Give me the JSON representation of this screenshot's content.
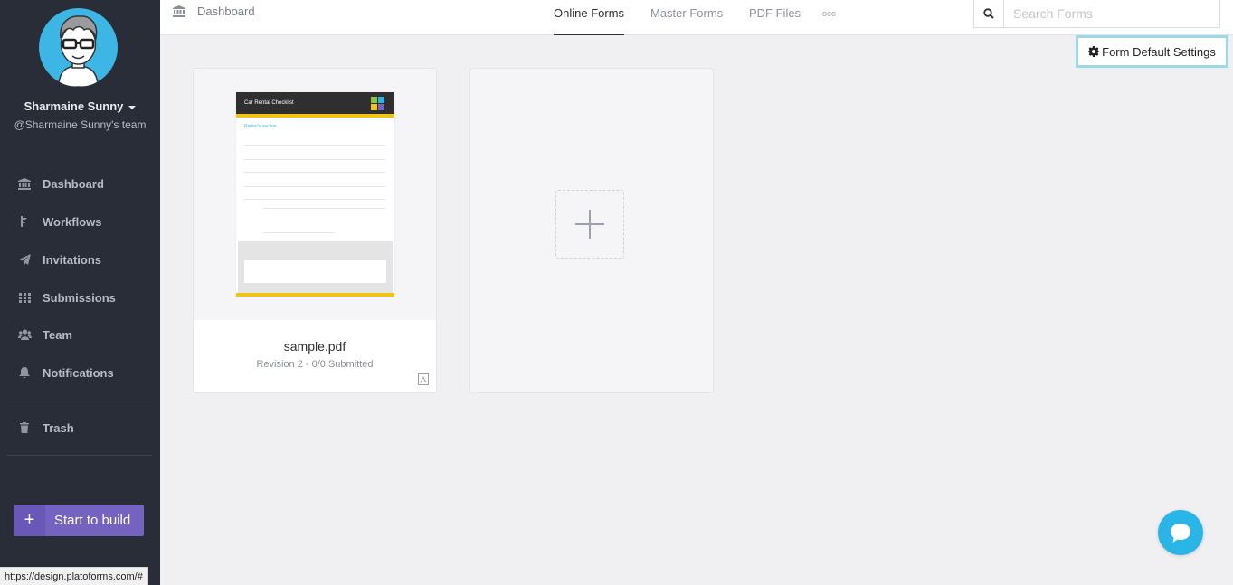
{
  "sidebar": {
    "user_name": "Sharmaine Sunny",
    "team": "@Sharmaine Sunny's team",
    "items": [
      {
        "label": "Dashboard",
        "icon": "bank-icon"
      },
      {
        "label": "Workflows",
        "icon": "workflow-icon"
      },
      {
        "label": "Invitations",
        "icon": "paper-plane-icon"
      },
      {
        "label": "Submissions",
        "icon": "grid-icon"
      },
      {
        "label": "Team",
        "icon": "users-icon"
      },
      {
        "label": "Notifications",
        "icon": "bell-icon"
      },
      {
        "label": "Trash",
        "icon": "trash-icon"
      }
    ],
    "build_button": "Start to build",
    "build_plus": "+"
  },
  "topbar": {
    "breadcrumb": "Dashboard",
    "tabs": [
      {
        "label": "Online Forms",
        "active": true
      },
      {
        "label": "Master Forms",
        "active": false
      },
      {
        "label": "PDF Files",
        "active": false
      }
    ],
    "more": "ooo",
    "search_placeholder": "Search Forms"
  },
  "settings_button": "Form Default Settings",
  "cards": [
    {
      "title": "sample.pdf",
      "subtitle": "Revision 2 - 0/0 Submitted",
      "thumbnail": {
        "header": "Car Rental Checklist",
        "section": "Renter's section"
      }
    }
  ],
  "status_url": "https://design.platoforms.com/#",
  "colors": {
    "sidebar": "#282d38",
    "accent": "#7563c2",
    "chat": "#29b6e7",
    "highlight": "#9ed9ea"
  }
}
